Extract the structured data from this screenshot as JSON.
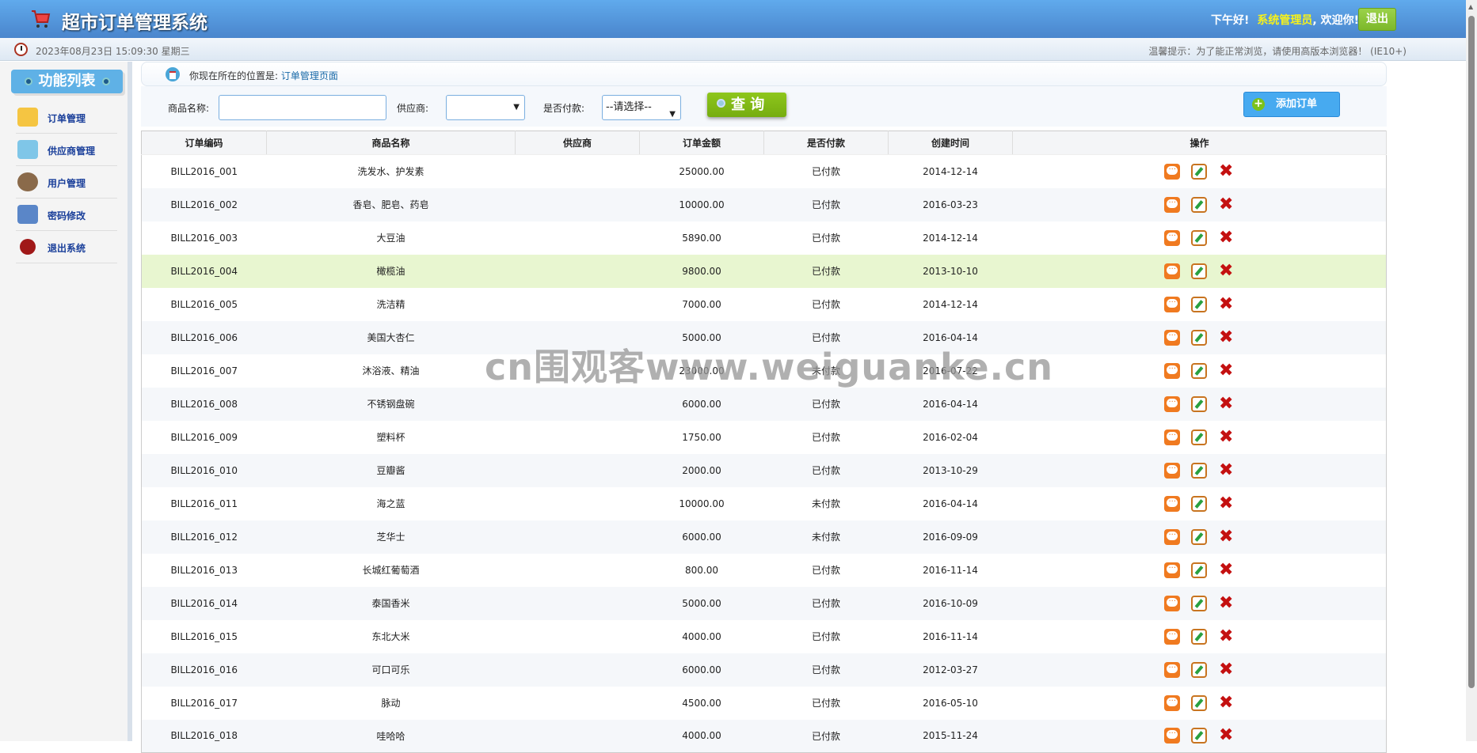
{
  "header": {
    "title": "超市订单管理系统",
    "greeting": "下午好!",
    "user": "系统管理员",
    "welcome": ", 欢迎你!",
    "logout": "退出"
  },
  "subbar": {
    "datetime": "2023年08月23日 15:09:30 星期三",
    "tip": "温馨提示：为了能正常浏览，请使用高版本浏览器！  (IE10+)"
  },
  "sidebar": {
    "title": "功能列表",
    "items": [
      {
        "label": "订单管理",
        "icon": "order-icon"
      },
      {
        "label": "供应商管理",
        "icon": "provider-icon"
      },
      {
        "label": "用户管理",
        "icon": "users-icon"
      },
      {
        "label": "密码修改",
        "icon": "lock-key-icon"
      },
      {
        "label": "退出系统",
        "icon": "exit-icon"
      }
    ]
  },
  "breadcrumb": {
    "prefix": "你现在所在的位置是:",
    "current": "订单管理页面"
  },
  "search": {
    "product_label": "商品名称:",
    "product_value": "",
    "provider_label": "供应商:",
    "provider_value": "",
    "paid_label": "是否付款:",
    "paid_value": "--请选择--",
    "query": "查 询",
    "add": "添加订单"
  },
  "table": {
    "headers": [
      "订单编码",
      "商品名称",
      "供应商",
      "订单金额",
      "是否付款",
      "创建时间",
      "操作"
    ],
    "rows": [
      [
        "BILL2016_001",
        "洗发水、护发素",
        "",
        "25000.00",
        "已付款",
        "2014-12-14"
      ],
      [
        "BILL2016_002",
        "香皂、肥皂、药皂",
        "",
        "10000.00",
        "已付款",
        "2016-03-23"
      ],
      [
        "BILL2016_003",
        "大豆油",
        "",
        "5890.00",
        "已付款",
        "2014-12-14"
      ],
      [
        "BILL2016_004",
        "橄榄油",
        "",
        "9800.00",
        "已付款",
        "2013-10-10"
      ],
      [
        "BILL2016_005",
        "洗洁精",
        "",
        "7000.00",
        "已付款",
        "2014-12-14"
      ],
      [
        "BILL2016_006",
        "美国大杏仁",
        "",
        "5000.00",
        "已付款",
        "2016-04-14"
      ],
      [
        "BILL2016_007",
        "沐浴液、精油",
        "",
        "23000.00",
        "未付款",
        "2016-07-22"
      ],
      [
        "BILL2016_008",
        "不锈钢盘碗",
        "",
        "6000.00",
        "已付款",
        "2016-04-14"
      ],
      [
        "BILL2016_009",
        "塑料杯",
        "",
        "1750.00",
        "已付款",
        "2016-02-04"
      ],
      [
        "BILL2016_010",
        "豆瓣酱",
        "",
        "2000.00",
        "已付款",
        "2013-10-29"
      ],
      [
        "BILL2016_011",
        "海之蓝",
        "",
        "10000.00",
        "未付款",
        "2016-04-14"
      ],
      [
        "BILL2016_012",
        "芝华士",
        "",
        "6000.00",
        "未付款",
        "2016-09-09"
      ],
      [
        "BILL2016_013",
        "长城红葡萄酒",
        "",
        "800.00",
        "已付款",
        "2016-11-14"
      ],
      [
        "BILL2016_014",
        "泰国香米",
        "",
        "5000.00",
        "已付款",
        "2016-10-09"
      ],
      [
        "BILL2016_015",
        "东北大米",
        "",
        "4000.00",
        "已付款",
        "2016-11-14"
      ],
      [
        "BILL2016_016",
        "可口可乐",
        "",
        "6000.00",
        "已付款",
        "2012-03-27"
      ],
      [
        "BILL2016_017",
        "脉动",
        "",
        "4500.00",
        "已付款",
        "2016-05-10"
      ],
      [
        "BILL2016_018",
        "哇哈哈",
        "",
        "4000.00",
        "已付款",
        "2015-11-24"
      ]
    ]
  },
  "watermark": "cn围观客www.weiguanke.cn"
}
